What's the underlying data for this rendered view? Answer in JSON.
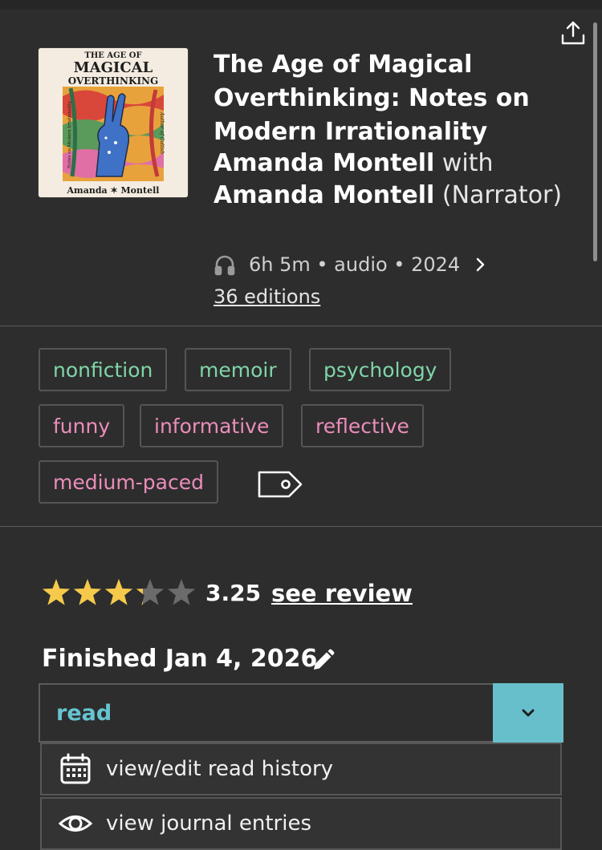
{
  "book": {
    "title": "The Age of Magical Overthinking: Notes on Modern Irrationality",
    "author": "Amanda Montell",
    "with_word": "with",
    "narrator": "Amanda Montell",
    "narrator_role": "(Narrator)",
    "meta": "6h 5m • audio • 2024",
    "editions": "36 editions"
  },
  "cover": {
    "line1": "THE AGE OF",
    "line2": "MAGICAL",
    "line3": "OVERTHINKING",
    "side_left": "Notes on Modern Irrationality",
    "side_right": "Author of Cultish",
    "author_line": "Amanda ✶ Montell"
  },
  "tags": {
    "genres": [
      "nonfiction",
      "memoir",
      "psychology"
    ],
    "moods": [
      "funny",
      "informative",
      "reflective",
      "medium-paced"
    ]
  },
  "rating": {
    "value": 3.25,
    "display": "3.25",
    "max": 5,
    "see_review": "see review"
  },
  "progress": {
    "finished_label": "Finished Jan 4, 2026",
    "status": "read"
  },
  "menu": {
    "history": "view/edit read history",
    "journal": "view journal entries"
  },
  "colors": {
    "background": "#2d2d2d",
    "genre_tag": "#7fd6a7",
    "mood_tag": "#ea8dba",
    "accent": "#68bfcc",
    "star_filled": "#f5c94a",
    "star_empty": "#6b6b6b"
  },
  "icons": {
    "share": "share-icon",
    "audio": "headphones-icon",
    "edit": "pencil-icon",
    "tag": "tag-icon",
    "history": "calendar-icon",
    "journal": "eye-icon"
  }
}
